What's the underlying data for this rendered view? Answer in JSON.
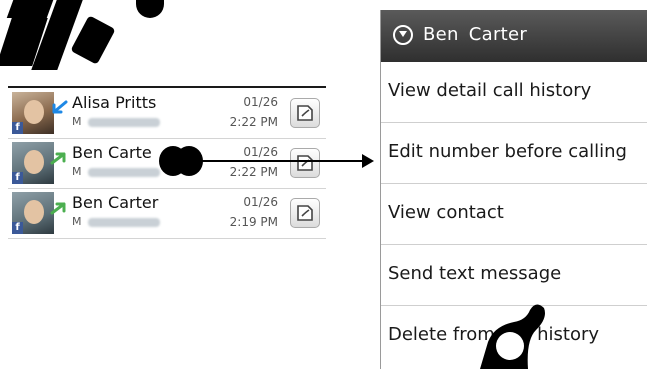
{
  "call_log": {
    "rows": [
      {
        "name": "Alisa Pritts",
        "type": "M",
        "date": "01/26",
        "time": "2:22 PM",
        "avatar_icon": "contact-photo",
        "badge": "f",
        "call_icon": "incoming-call-icon"
      },
      {
        "name": "Ben  Carte",
        "type": "M",
        "date": "01/26",
        "time": "2:22 PM",
        "avatar_icon": "contact-photo",
        "badge": "f",
        "call_icon": "outgoing-call-icon"
      },
      {
        "name": "Ben  Carter",
        "type": "M",
        "date": "01/26",
        "time": "2:19 PM",
        "avatar_icon": "contact-photo",
        "badge": "f",
        "call_icon": "outgoing-call-icon"
      }
    ],
    "action_icon": "send-message-icon"
  },
  "context_menu": {
    "title": "Ben  Carter",
    "header_icon": "chevron-down-icon",
    "items": [
      {
        "label": "View detail call history"
      },
      {
        "label": "Edit number before calling"
      },
      {
        "label": "View contact"
      },
      {
        "label": "Send text message"
      },
      {
        "label": "Delete from call history"
      }
    ]
  },
  "colors": {
    "header_dark": "#2f2f2f",
    "facebook_blue": "#3b5998",
    "call_arrow_green": "#4caf50",
    "incoming_arrow_blue": "#1e88e5"
  }
}
